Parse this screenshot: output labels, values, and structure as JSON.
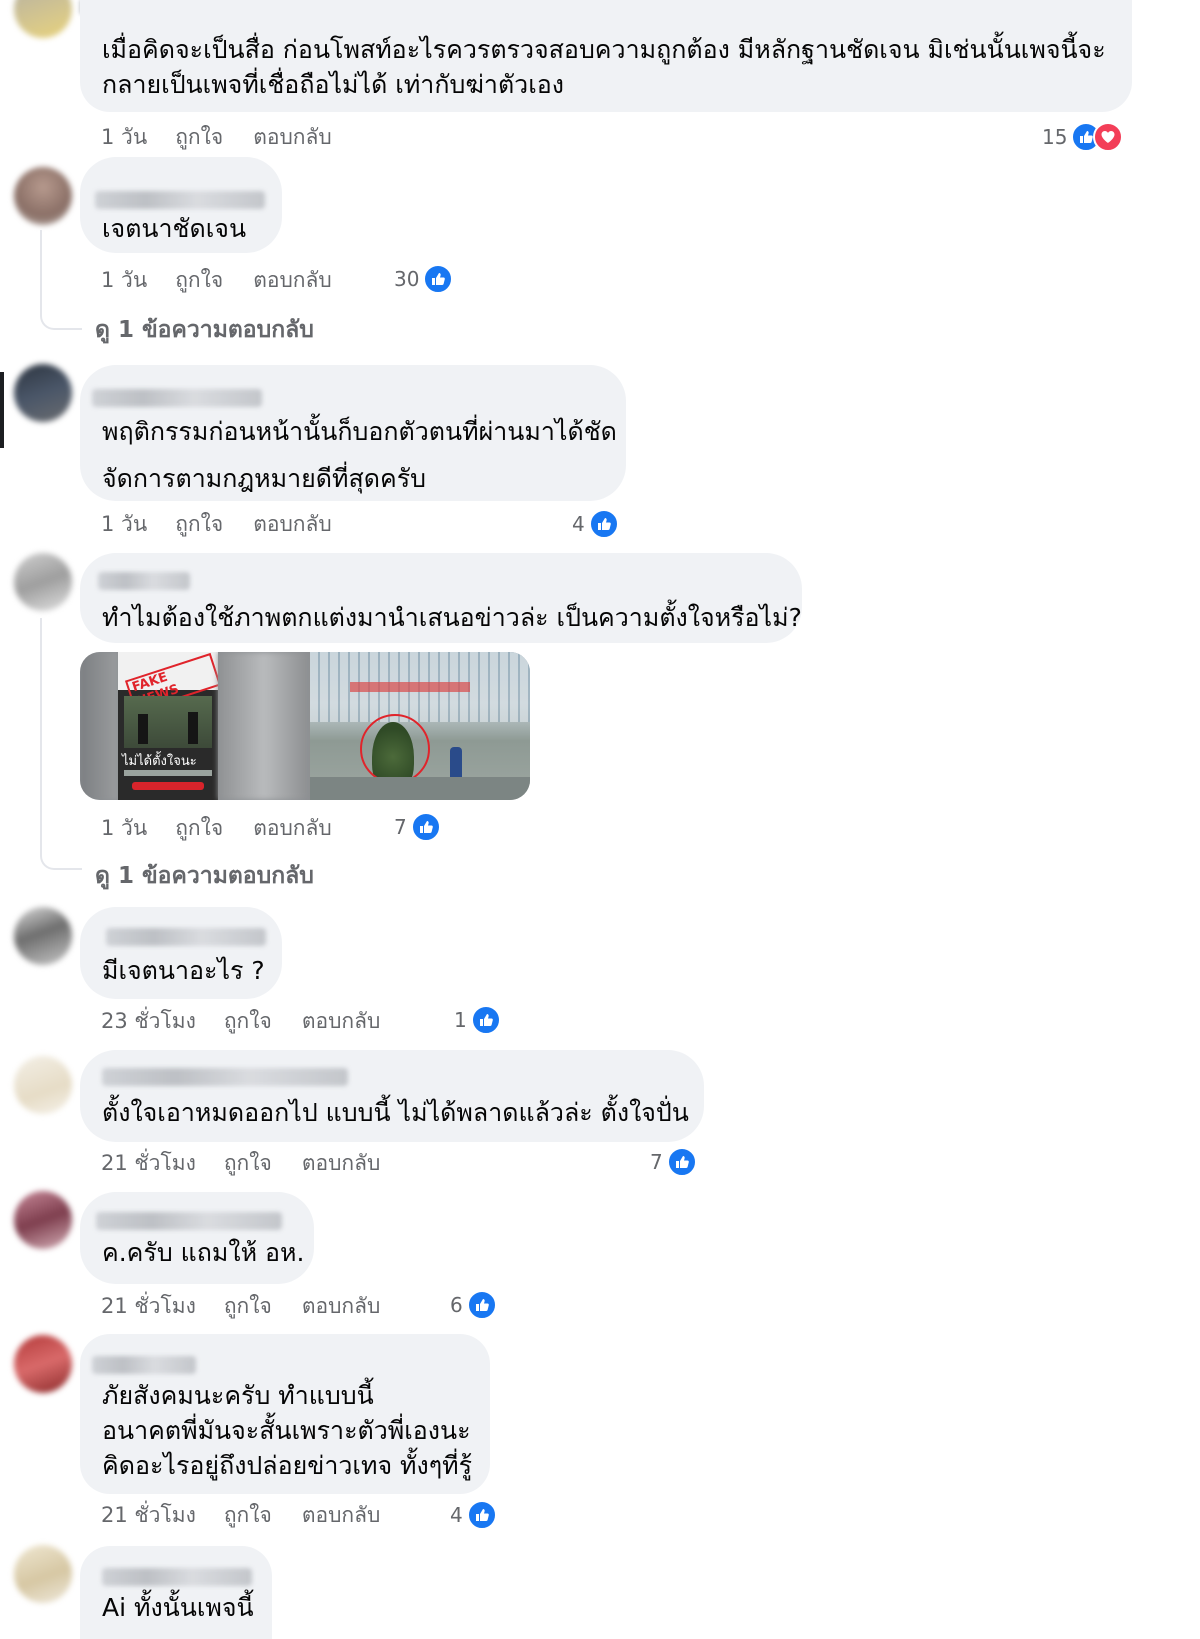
{
  "actions": {
    "like": "ถูกใจ",
    "reply": "ตอบกลับ"
  },
  "colors": {
    "like_blue": "#1877f2",
    "love_red": "#f33e58",
    "bubble_bg": "#f0f2f5",
    "meta_gray": "#65676b"
  },
  "comments": [
    {
      "text": "เมื่อคิดจะเป็นสื่อ ก่อนโพสท์อะไรควรตรวจสอบความถูกต้อง มีหลักฐานชัดเจน มิเช่นนั้นเพจนี้จะ\nกลายเป็นเพจที่เชื่อถือไม่ได้ เท่ากับฆ่าตัวเอง",
      "time": "1 วัน",
      "reactions": "15",
      "reaction_icons": [
        "like-icon",
        "love-icon"
      ]
    },
    {
      "text": "เจตนาชัดเจน",
      "time": "1 วัน",
      "reactions": "30",
      "view_replies": "ดู 1 ข้อความตอบกลับ"
    },
    {
      "text": "พฤติกรรมก่อนหน้านั้นก็บอกตัวตนที่ผ่านมาได้ชัด\nจัดการตามกฎหมายดีที่สุดครับ",
      "time": "1 วัน",
      "reactions": "4"
    },
    {
      "text": "ทำไมต้องใช้ภาพตกแต่งมานำเสนอข่าวล่ะ เป็นความตั้งใจหรือไม่?",
      "time": "1 วัน",
      "reactions": "7",
      "view_replies": "ดู 1 ข้อความตอบกลับ",
      "attachment": {
        "left_stamp": "FAKE NEWS",
        "left_caption": "ไม่ได้ตั้งใจนะ"
      }
    },
    {
      "text": "มีเจตนาอะไร ?",
      "time": "23 ชั่วโมง",
      "reactions": "1"
    },
    {
      "text": "ตั้งใจเอาหมดออกไป แบบนี้ ไม่ได้พลาดแล้วล่ะ ตั้งใจปั่น",
      "time": "21 ชั่วโมง",
      "reactions": "7"
    },
    {
      "text": "ค.ครับ แถมให้ อห.",
      "time": "21 ชั่วโมง",
      "reactions": "6"
    },
    {
      "text": "ภัยสังคมนะครับ ทำแบบนี้\nอนาคตพี่มันจะสั้นเพราะตัวพี่เองนะ\nคิดอะไรอยู่ถึงปล่อยข่าวเทจ ทั้งๆที่รู้",
      "time": "21 ชั่วโมง",
      "reactions": "4"
    },
    {
      "text": "Ai ทั้งนั้นเพจนี้"
    }
  ]
}
